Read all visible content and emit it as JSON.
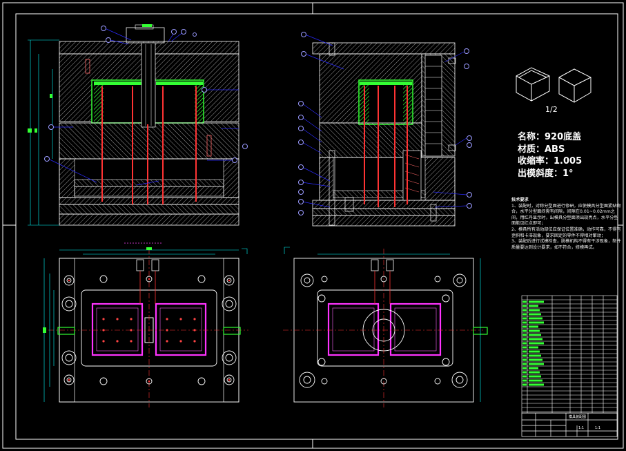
{
  "ratio_label": "1/2",
  "part": {
    "name_line": "名称：920底盖",
    "material_line": "材质：ABS",
    "shrink_line": "收缩率：1.005",
    "draft_line": "出模斜度：1°"
  },
  "notes": {
    "title": "技术要求",
    "lines": [
      "1、装配时，对称分型面进行修研，应使模具分型面紧贴吻合，水平分型面间需有间隙，间隙在0.01~0.02mm之间，用红丹显示时，出模具分型面须出现亮点，水平分型面能见红点即可；",
      "2、模具所有活动部位应保证位置准确，动作可靠，不得有歪斜和卡滞现象，要求固定的零件不得相对窜动；",
      "3、装配后进行试模检查，脱模机构不得有干涉现象，制件质量要达到设计要求，如不符合，修模再试。"
    ]
  },
  "titleblock": {
    "name_cell": "模具装配图",
    "scale_cell": "1:1",
    "sheet_cell": "1:1"
  },
  "colors": {
    "background": "#000000",
    "frame": "#ffffff",
    "hatch": "#bdbdbd",
    "cavity": "#33ff33",
    "ejector": "#ff3333",
    "dimension": "#00ffff",
    "balloon": "#9a9aff",
    "cavity_outline": "#ff33ff"
  }
}
